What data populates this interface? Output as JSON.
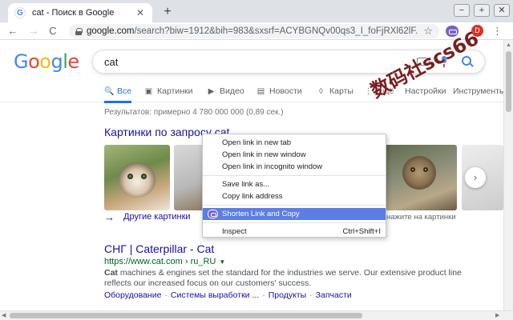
{
  "browser": {
    "tab_title": "cat - Поиск в Google",
    "tab_favicon_letter": "G",
    "tab_close": "✕",
    "new_tab": "+",
    "window_controls": {
      "minimize": "−",
      "maximize": "+",
      "close": "✕"
    },
    "nav": {
      "back": "←",
      "forward": "→",
      "reload": "C"
    },
    "url_host": "google.com",
    "url_rest": "/search?biw=1912&bih=983&sxsrf=ACYBGNQv00qs3_I_foFjRXl62lF...",
    "star_icon": "☆",
    "profile_letter": "D",
    "menu_icon": "⋮",
    "ext_color": "#7b61c4"
  },
  "google": {
    "logo_letters": [
      "G",
      "o",
      "o",
      "g",
      "l",
      "e"
    ],
    "search_query": "cat",
    "tabs": [
      {
        "label": "Все",
        "icon": "🔍",
        "active": true
      },
      {
        "label": "Картинки",
        "icon": "▣",
        "active": false
      },
      {
        "label": "Видео",
        "icon": "▶",
        "active": false
      },
      {
        "label": "Новости",
        "icon": "▤",
        "active": false
      },
      {
        "label": "Карты",
        "icon": "◊",
        "active": false
      },
      {
        "label": "Ещё",
        "icon": "⋮",
        "active": false
      },
      {
        "label": "Настройки",
        "icon": "",
        "active": false
      },
      {
        "label": "Инструменты",
        "icon": "",
        "active": false
      }
    ],
    "result_stats": "Результатов: примерно 4 780 000 000 (0,89 сек.)",
    "images_heading": "Картинки по запросу cat",
    "more_images": "Другие картинки",
    "more_images_arrow": "→",
    "similar_images": "нажите на картинки",
    "next_arrow": "›",
    "result": {
      "title": "СНГ | Caterpillar - Cat",
      "url": "https://www.cat.com › ru_RU",
      "url_caret": "▼",
      "snippet_bold": "Cat",
      "snippet_rest": " machines & engines set the standard for the industries we serve. Our extensive product line reflects our increased focus on our customers' success.",
      "sitelinks": [
        "Оборудование",
        "Системы выработки ...",
        "Продукты",
        "Запчасти"
      ],
      "sitelink_separator": "·"
    }
  },
  "context_menu": {
    "items": [
      {
        "label": "Open link in new tab",
        "shortcut": ""
      },
      {
        "label": "Open link in new window",
        "shortcut": ""
      },
      {
        "label": "Open link in incognito window",
        "shortcut": ""
      },
      {
        "label": "Save link as...",
        "shortcut": ""
      },
      {
        "label": "Copy link address",
        "shortcut": ""
      },
      {
        "label": "Shorten Link and Copy",
        "shortcut": "",
        "highlight": true
      },
      {
        "label": "Inspect",
        "shortcut": "Ctrl+Shift+I"
      }
    ],
    "highlight_color": "#5b7ee5"
  },
  "watermark": "数码社scs66",
  "scrollbars": {
    "up": "▲",
    "left": "◀",
    "right": "▶"
  }
}
